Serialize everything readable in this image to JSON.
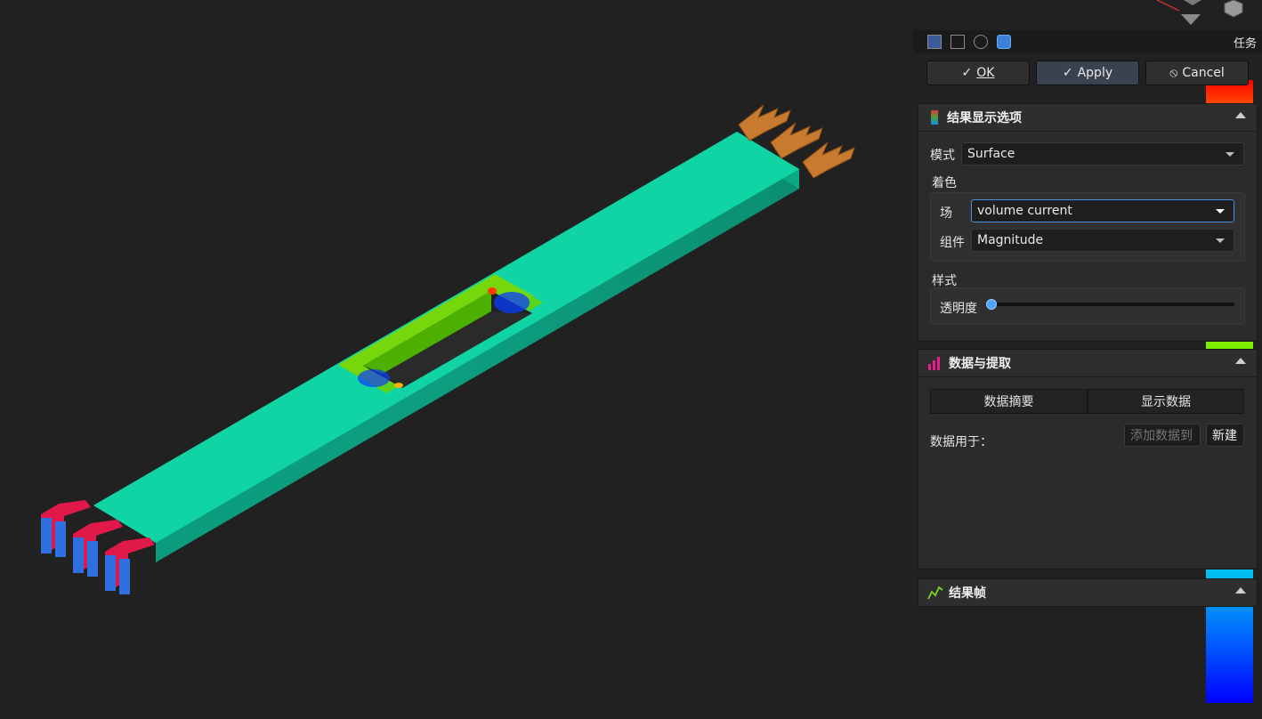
{
  "toolbar": {
    "task_label": "任务"
  },
  "actions": {
    "ok": "OK",
    "apply": "Apply",
    "cancel": "Cancel"
  },
  "display_options": {
    "title": "结果显示选项",
    "mode_label": "模式",
    "mode_value": "Surface",
    "coloring_label": "着色",
    "field_label": "场",
    "field_value": "volume current",
    "component_label": "组件",
    "component_value": "Magnitude",
    "style_label": "样式",
    "transparency_label": "透明度",
    "transparency_value": 0
  },
  "data_extraction": {
    "title": "数据与提取",
    "summary_button": "数据摘要",
    "show_data_button": "显示数据",
    "data_for_label": "数据用于：",
    "add_data_placeholder": "添加数据到",
    "new_button": "新建"
  },
  "result_frames": {
    "title": "结果帧"
  },
  "colors": {
    "accent": "#4aa3ff",
    "constraint_red": "#e0194a",
    "constraint_blue": "#2f6fe0",
    "load_orange": "#c87a2e",
    "body_teal": "#0fd6a0"
  }
}
